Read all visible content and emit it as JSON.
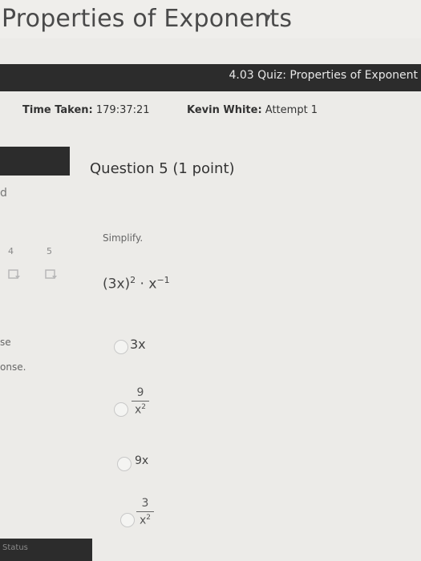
{
  "page_title": "Properties of Exponents",
  "quiz": {
    "title": "4.03 Quiz: Properties of Exponent"
  },
  "meta": {
    "time_label": "Time Taken:",
    "time_value": "179:37:21",
    "user_label": "Kevin White:",
    "attempt": "Attempt 1"
  },
  "question": {
    "heading": "Question 5 (1 point)",
    "prompt": "Simplify.",
    "expr_base": "(3x)",
    "expr_exp1": "2",
    "expr_mid": " · x",
    "expr_exp2": "−1"
  },
  "nav": {
    "num_4": "4",
    "num_5": "5",
    "frag_d": "d",
    "frag_se": "se",
    "frag_onse": "onse."
  },
  "options": [
    {
      "text": "3x"
    },
    {
      "numerator": "9",
      "denominator": "x",
      "den_exp": "2"
    },
    {
      "text": "9x"
    },
    {
      "numerator": "3",
      "denominator": "x",
      "den_exp": "2"
    }
  ],
  "status": "Status"
}
